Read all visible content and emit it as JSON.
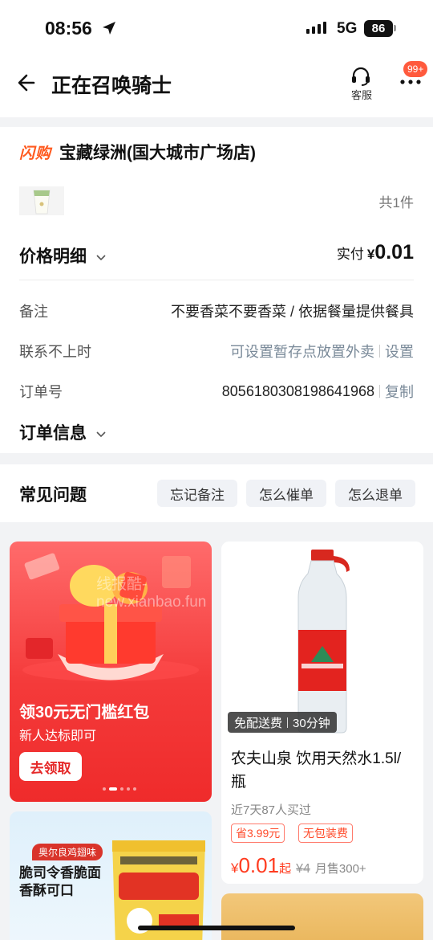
{
  "status_bar": {
    "time": "08:56",
    "network": "5G",
    "battery": "86"
  },
  "nav": {
    "title": "正在召唤骑士",
    "customer_service_label": "客服",
    "badge": "99+"
  },
  "order": {
    "brand_logo": "闪购",
    "store_name": "宝藏绿洲(国大城市广场店)",
    "item_count": "共1件",
    "price_detail_label": "价格明细",
    "paid_label": "实付",
    "paid_currency": "¥",
    "paid_amount": "0.01",
    "rows": [
      {
        "label": "备注",
        "value": "不要香菜不要香菜 / 依据餐量提供餐具"
      },
      {
        "label": "联系不上时",
        "value": "可设置暂存点放置外卖",
        "action": "设置"
      },
      {
        "label": "订单号",
        "value": "8056180308198641968",
        "action": "复制"
      }
    ],
    "order_info_label": "订单信息"
  },
  "faq": {
    "title": "常见问题",
    "chips": [
      "忘记备注",
      "怎么催单",
      "怎么退单"
    ]
  },
  "feed": {
    "promo": {
      "title": "领30元无门槛红包",
      "subtitle": "新人达标即可",
      "button": "去领取"
    },
    "snack": {
      "tag": "奥尔良鸡翅味",
      "text": "脆司令香脆面香酥可口"
    },
    "product": {
      "delivery_free": "免配送费",
      "delivery_time": "30分钟",
      "name": "农夫山泉 饮用天然水1.5l/瓶",
      "sold": "近7天87人买过",
      "save_chip": "省3.99元",
      "free_pack_chip": "无包装费",
      "currency": "¥",
      "price": "0.01",
      "price_suffix": "起",
      "original_price": "¥4",
      "monthly_sales": "月售300+"
    }
  },
  "watermark": "线报酷-new.xianbao.fun",
  "colors": {
    "accent": "#ff3b1f",
    "brand_orange": "#ff5a1f",
    "promo_red": "#ef2b2b"
  }
}
